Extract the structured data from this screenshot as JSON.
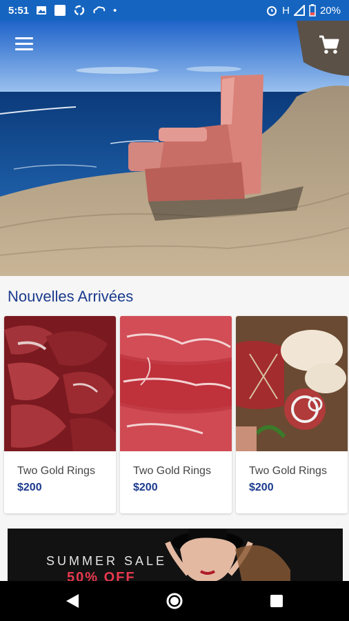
{
  "status": {
    "time": "5:51",
    "battery": "20%",
    "network": "H",
    "left_icons": [
      "image-icon",
      "square-icon",
      "sync-icon",
      "cloud-icon",
      "dot-icon"
    ],
    "right_icons": [
      "alarm-icon",
      "signal-icon",
      "battery-icon"
    ]
  },
  "header": {
    "menu_icon": "hamburger-menu-icon",
    "cart_icon": "shopping-cart-icon"
  },
  "section": {
    "title": "Nouvelles Arrivées"
  },
  "products": [
    {
      "name": "Two Gold Rings",
      "price": "$200",
      "image": "raw-meat-chunks"
    },
    {
      "name": "Two Gold Rings",
      "price": "$200",
      "image": "marbled-steaks"
    },
    {
      "name": "Two Gold Rings",
      "price": "$200",
      "image": "meat-and-chicken-board"
    }
  ],
  "banner": {
    "title": "SUMMER SALE",
    "offer": "50% OFF"
  },
  "nav": {
    "back_icon": "back-triangle-icon",
    "home_icon": "home-circle-icon",
    "recents_icon": "recents-square-icon"
  },
  "colors": {
    "status_bar": "#1565c0",
    "accent_text": "#1a3a8c",
    "sale_red": "#e8384f"
  }
}
